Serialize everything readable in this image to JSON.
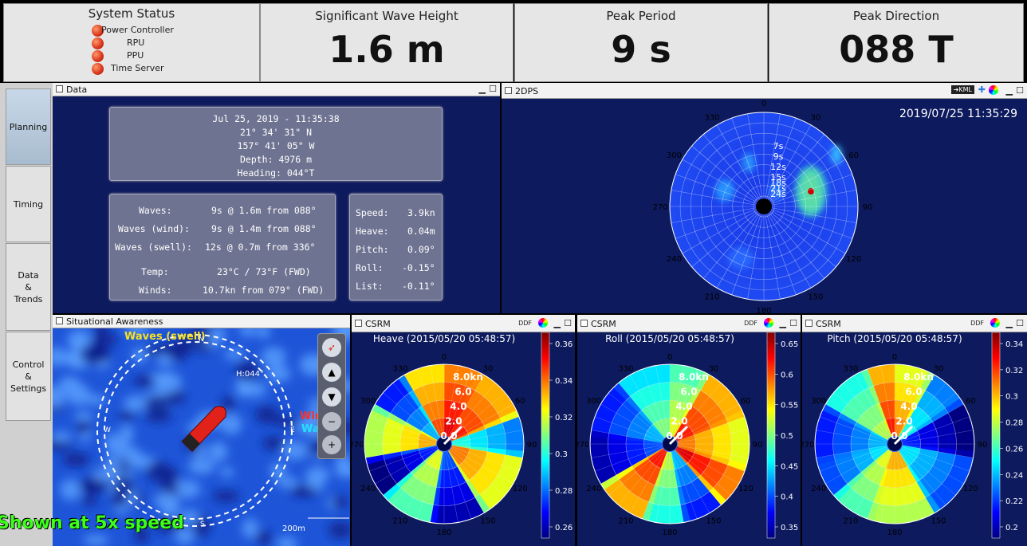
{
  "header": {
    "status_title": "System Status",
    "status_items": [
      "Power Controller",
      "RPU",
      "PPU",
      "Time Server"
    ],
    "tiles": [
      {
        "title": "Significant Wave Height",
        "value": "1.6 m"
      },
      {
        "title": "Peak Period",
        "value": "9 s"
      },
      {
        "title": "Peak Direction",
        "value": "088 T"
      }
    ]
  },
  "nav": {
    "items": [
      {
        "label": "Planning",
        "active": true
      },
      {
        "label": "Timing"
      },
      {
        "label": "Data\n&\nTrends"
      },
      {
        "label": "Control\n&\nSettings"
      }
    ]
  },
  "data_panel": {
    "title": "Data",
    "position_lines": [
      "Jul 25, 2019 - 11:35:38",
      "21° 34' 31\" N",
      "157° 41' 05\" W",
      "Depth: 4976 m",
      "Heading: 044°T"
    ],
    "waves": [
      {
        "label": "Waves:",
        "value": "9s @ 1.6m from 088°"
      },
      {
        "label": "Waves (wind):",
        "value": "9s @ 1.4m from 088°"
      },
      {
        "label": "Waves (swell):",
        "value": "12s @ 0.7m from 336°"
      },
      {
        "label": "Temp:",
        "value": "23°C / 73°F (FWD)"
      },
      {
        "label": "Winds:",
        "value": "10.7kn from 079° (FWD)"
      }
    ],
    "motion": [
      {
        "label": "Speed:",
        "value": "3.9kn"
      },
      {
        "label": "Heave:",
        "value": "0.04m"
      },
      {
        "label": "Pitch:",
        "value": "0.09°"
      },
      {
        "label": "Roll:",
        "value": "-0.15°"
      },
      {
        "label": "List:",
        "value": "-0.11°"
      }
    ]
  },
  "dps_panel": {
    "title": "2DPS",
    "kml_label": "KML",
    "timestamp": "2019/07/25 11:35:29",
    "angle_labels": [
      "0",
      "30",
      "60",
      "90",
      "120",
      "150",
      "180",
      "210",
      "240",
      "270",
      "300",
      "330"
    ],
    "period_labels": [
      "7s",
      "9s",
      "12s",
      "15s",
      "18s",
      "21s",
      "24s"
    ]
  },
  "sa_panel": {
    "title": "Situational Awareness",
    "waves_swell_label": "Waves (swell)",
    "heading_label": "H:044°",
    "wind_label": "Wind",
    "waves_label": "Wa",
    "scale_label": "200m",
    "overlay_text": "Shown at 5x speed",
    "compass_w": "W",
    "compass_e": "E",
    "compass_s": "S",
    "compass_n": "N"
  },
  "csrm": [
    {
      "title": "CSRM",
      "chart_title": "Heave (2015/05/20 05:48:57)",
      "ticks": [
        "0.36",
        "0.34",
        "0.32",
        "0.3",
        "0.28",
        "0.26"
      ]
    },
    {
      "title": "CSRM",
      "chart_title": "Roll (2015/05/20 05:48:57)",
      "ticks": [
        "0.65",
        "0.6",
        "0.55",
        "0.5",
        "0.45",
        "0.4",
        "0.35"
      ]
    },
    {
      "title": "CSRM",
      "chart_title": "Pitch (2015/05/20 05:48:57)",
      "ticks": [
        "0.34",
        "0.32",
        "0.3",
        "0.28",
        "0.26",
        "0.24",
        "0.22",
        "0.2"
      ]
    }
  ],
  "csrm_common": {
    "ddf_label": "DDF",
    "speed_labels": [
      "8.0kn",
      "6.0",
      "4.0",
      "2.0",
      "0.0"
    ],
    "angle_labels": [
      "0",
      "30",
      "60",
      "90",
      "120",
      "150",
      "180",
      "210",
      "240",
      "270",
      "300",
      "330"
    ]
  },
  "colors": {
    "panel_bg": "#0d1a5e",
    "sa_sea": "#1d4fd0",
    "header_bg": "#e6e6e6"
  }
}
